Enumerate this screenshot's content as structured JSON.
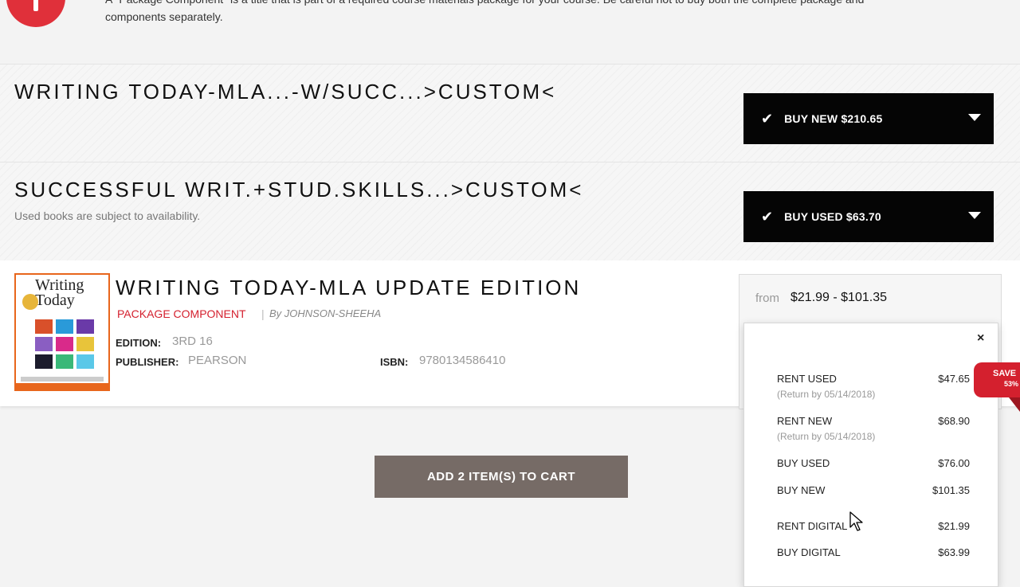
{
  "notice": {
    "text": "A \"Package Component\" is a title that is part of a required course materials package for your course. Be careful not to buy both the complete package and components separately."
  },
  "rows": [
    {
      "title": "WRITING TODAY-MLA...-W/SUCC...>CUSTOM<",
      "button_label": "BUY NEW $210.65"
    },
    {
      "title": "SUCCESSFUL WRIT.+STUD.SKILLS...>CUSTOM<",
      "subtitle": "Used books are subject to availability.",
      "button_label": "BUY USED $63.70"
    }
  ],
  "product": {
    "cover_title": "Writing Today",
    "title": "WRITING TODAY-MLA UPDATE EDITION",
    "package_label": "PACKAGE COMPONENT",
    "separator": "|",
    "author": "By JOHNSON-SHEEHA",
    "edition_label": "EDITION:",
    "edition_value": "3RD 16",
    "publisher_label": "PUBLISHER:",
    "publisher_value": "PEARSON",
    "isbn_label": "ISBN:",
    "isbn_value": "9780134586410"
  },
  "price": {
    "from_label": "from",
    "range": "$21.99 - $101.35",
    "close_glyph": "×",
    "save_label": "SAVE",
    "save_percent": "53%",
    "options": [
      {
        "name": "RENT USED",
        "note": "(Return by 05/14/2018)",
        "price": "$47.65"
      },
      {
        "name": "RENT NEW",
        "note": "(Return by 05/14/2018)",
        "price": "$68.90"
      },
      {
        "name": "BUY USED",
        "note": "",
        "price": "$76.00"
      },
      {
        "name": "BUY NEW",
        "note": "",
        "price": "$101.35"
      },
      {
        "name": "RENT DIGITAL",
        "note": "",
        "price": "$21.99"
      },
      {
        "name": "BUY DIGITAL",
        "note": "",
        "price": "$63.99"
      }
    ]
  },
  "cart": {
    "add_label": "ADD 2 ITEM(S) TO CART"
  },
  "colors": {
    "accent_red": "#d4202e",
    "button_dark": "#050505",
    "add_button": "#766b66",
    "cover_border": "#e8661c"
  },
  "icons": [
    "alert-icon",
    "checkmark-icon",
    "caret-down-icon",
    "close-icon",
    "mouse-cursor-icon"
  ]
}
